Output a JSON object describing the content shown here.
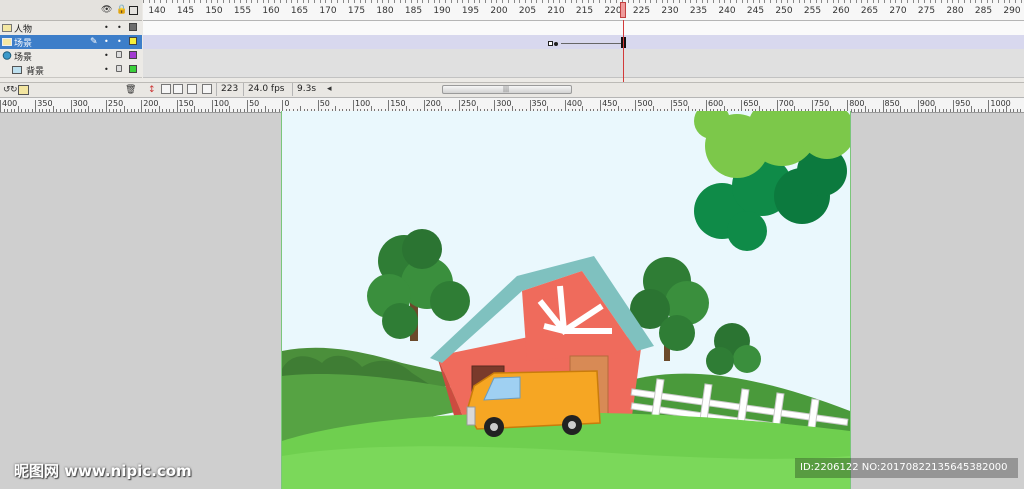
{
  "timeline": {
    "frame_numbers": [
      "140",
      "145",
      "150",
      "155",
      "160",
      "165",
      "170",
      "175",
      "180",
      "185",
      "190",
      "195",
      "200",
      "205",
      "210",
      "215",
      "220",
      "225",
      "230",
      "235",
      "240",
      "245",
      "250",
      "255",
      "260",
      "265",
      "270",
      "275",
      "280",
      "285",
      "290"
    ],
    "current_frame": "223",
    "fps": "24.0 fps",
    "elapsed": "9.3s",
    "scroll_arrow": "◂",
    "layers": [
      {
        "name": "人物",
        "visible": "•",
        "locked": "•",
        "color": "#6d6d6d",
        "selected": false
      },
      {
        "name": "场景",
        "visible": "•",
        "locked": "•",
        "color": "#f5ef3a",
        "selected": true
      },
      {
        "name": "场景",
        "visible": "•",
        "locked": "🔒",
        "color": "#a23ad0",
        "selected": false
      },
      {
        "name": "背景",
        "visible": "•",
        "locked": "🔒",
        "color": "#3ad03a",
        "selected": false
      }
    ]
  },
  "ruler": {
    "labels": [
      "400",
      "350",
      "300",
      "250",
      "200",
      "150",
      "100",
      "50",
      "0",
      "50",
      "100",
      "150",
      "200",
      "250",
      "300",
      "350",
      "400",
      "450",
      "500",
      "550",
      "600",
      "650",
      "700",
      "750",
      "800",
      "850",
      "900",
      "950",
      "1000"
    ]
  },
  "stage": {
    "sky_color": "#eaf8fd",
    "grass_color": "#6fcf4f",
    "barn_color": "#ef6b5c",
    "roof_color": "#7fc1bf",
    "van_color": "#f6a623"
  },
  "overlay": {
    "watermark": "昵图网 www.nipic.com",
    "id_text": "ID:2206122 NO:20170822135645382000"
  }
}
